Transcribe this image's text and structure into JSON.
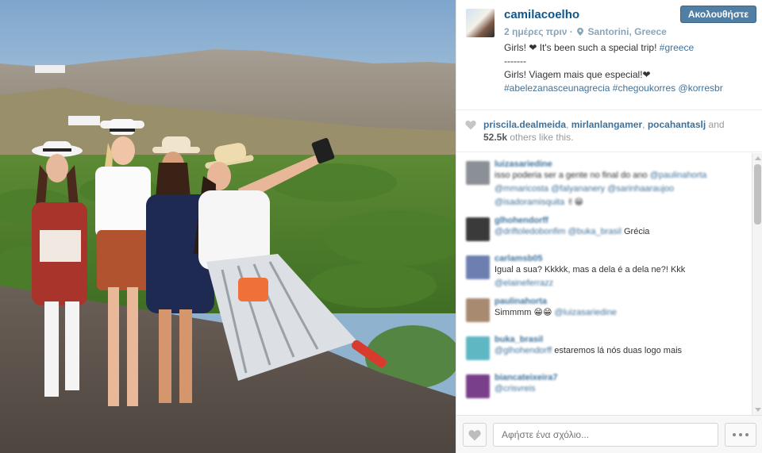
{
  "post": {
    "username": "camilacoelho",
    "follow_label": "Ακολουθήστε",
    "time_ago": "2 ημέρες πριν",
    "separator": "·",
    "location": "Santorini, Greece",
    "caption_line1": "Girls! ❤ It's been such a special trip!",
    "caption_tag1": "#greece",
    "caption_divider": "-------",
    "caption_line2": "Girls! Viagem mais que especial!❤",
    "caption_tags2": [
      "#abelezanasceunagrecia",
      "#chegoukorres",
      "@korresbr"
    ]
  },
  "likes": {
    "users": [
      "priscila.dealmeida",
      "mirlanlangamer",
      "pocahantaslj"
    ],
    "sep_comma": ",",
    "and_label": "and",
    "count": "52.5k",
    "others_label": "others like this."
  },
  "comments": [
    {
      "user": "luizasariedine",
      "text": "isso poderia ser a gente no final do ano",
      "mentions": [
        "@paulinahorta",
        "@mmaricosta",
        "@falyananery",
        "@sarinhaaraujoo",
        "@isadoramisquita",
        "✌😁"
      ],
      "avatar_color": "#8b8f96"
    },
    {
      "user": "glhohendorff",
      "text": "",
      "mentions": [
        "@driftoledobonfim",
        "@buka_brasil"
      ],
      "after": "Grécia",
      "avatar_color": "#3a3a3a"
    },
    {
      "user": "carlamsb05",
      "text": "Igual a sua? Kkkkk, mas a dela é a dela ne?! Kkk",
      "mentions": [
        "@elaineferrazz"
      ],
      "avatar_color": "#6d7fb0"
    },
    {
      "user": "paulinahorta",
      "text": "Simmmm 😁😁",
      "mentions": [
        "@luizasariedine"
      ],
      "avatar_color": "#a88a70"
    },
    {
      "user": "buka_brasil",
      "text": "",
      "mentions": [
        "@glhohendorff"
      ],
      "after": "estaremos lá nós duas logo mais",
      "avatar_color": "#5fb7c4"
    },
    {
      "user": "biancateixeira7",
      "text": "",
      "mentions": [
        "@crisvreis"
      ],
      "avatar_color": "#7a3f8a"
    }
  ],
  "footer": {
    "comment_placeholder": "Αφήστε ένα σχόλιο..."
  },
  "colors": {
    "accent": "#517fa4",
    "link": "#3f729b",
    "username": "#125688"
  },
  "icons": [
    "heart-icon",
    "location-pin-icon",
    "more-dots-icon"
  ]
}
